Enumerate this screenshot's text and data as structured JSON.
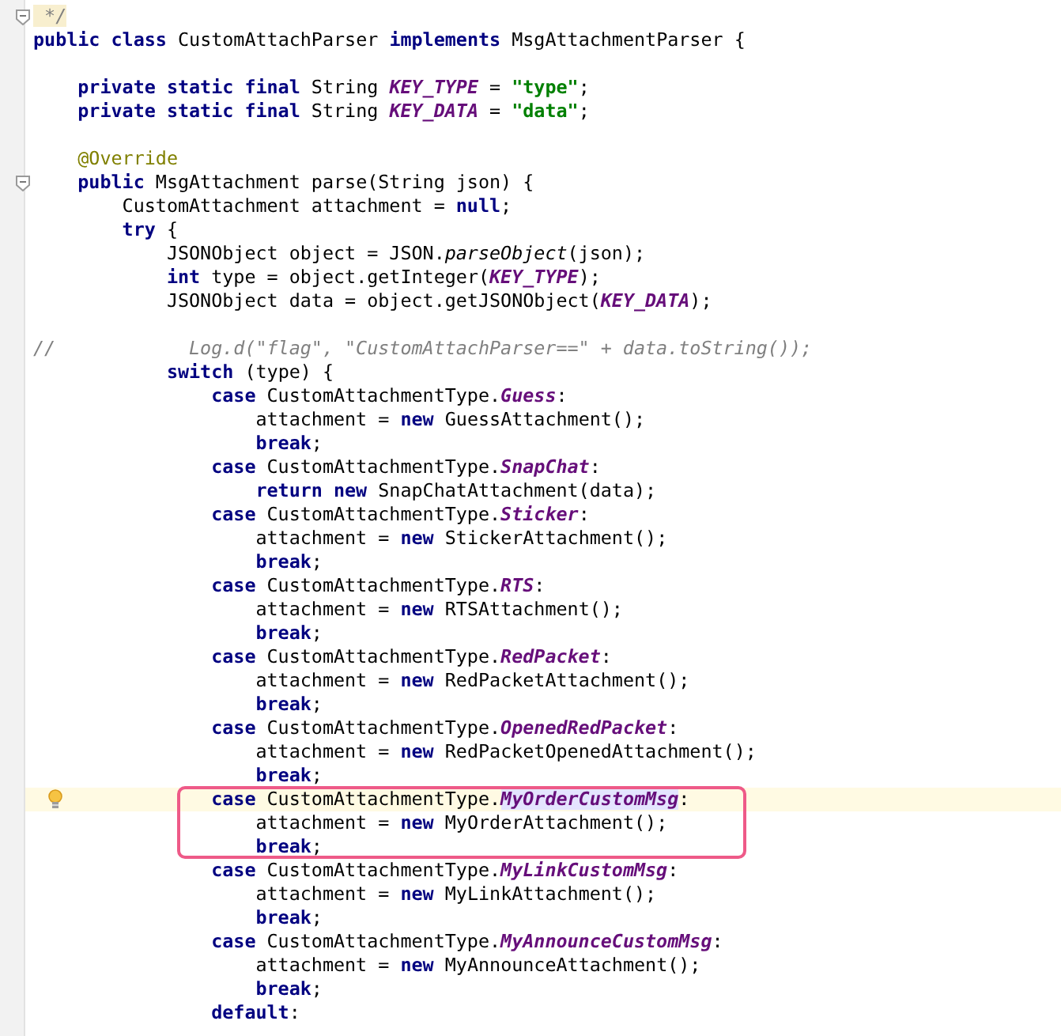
{
  "editor": {
    "lines": [
      {
        "kind": "code",
        "fold": true,
        "tokens": [
          {
            "kind": "doc",
            "text": " */"
          }
        ]
      },
      {
        "kind": "code",
        "tokens": [
          {
            "kind": "kw",
            "text": "public class"
          },
          {
            "kind": "plain",
            "text": " CustomAttachParser "
          },
          {
            "kind": "kw",
            "text": "implements"
          },
          {
            "kind": "plain",
            "text": " MsgAttachmentParser {"
          }
        ]
      },
      {
        "kind": "blank"
      },
      {
        "kind": "code",
        "tokens": [
          {
            "kind": "kw",
            "text": "    private static final"
          },
          {
            "kind": "plain",
            "text": " String "
          },
          {
            "kind": "field",
            "text": "KEY_TYPE"
          },
          {
            "kind": "plain",
            "text": " = "
          },
          {
            "kind": "str",
            "text": "\"type\""
          },
          {
            "kind": "plain",
            "text": ";"
          }
        ]
      },
      {
        "kind": "code",
        "tokens": [
          {
            "kind": "kw",
            "text": "    private static final"
          },
          {
            "kind": "plain",
            "text": " String "
          },
          {
            "kind": "field",
            "text": "KEY_DATA"
          },
          {
            "kind": "plain",
            "text": " = "
          },
          {
            "kind": "str",
            "text": "\"data\""
          },
          {
            "kind": "plain",
            "text": ";"
          }
        ]
      },
      {
        "kind": "blank"
      },
      {
        "kind": "code",
        "tokens": [
          {
            "kind": "ann",
            "text": "    @Override"
          }
        ]
      },
      {
        "kind": "code",
        "fold": true,
        "tokens": [
          {
            "kind": "kw",
            "text": "    public"
          },
          {
            "kind": "plain",
            "text": " MsgAttachment parse(String json) {"
          }
        ]
      },
      {
        "kind": "code",
        "tokens": [
          {
            "kind": "plain",
            "text": "        CustomAttachment attachment = "
          },
          {
            "kind": "kw",
            "text": "null"
          },
          {
            "kind": "plain",
            "text": ";"
          }
        ]
      },
      {
        "kind": "code",
        "tokens": [
          {
            "kind": "kw",
            "text": "        try"
          },
          {
            "kind": "plain",
            "text": " {"
          }
        ]
      },
      {
        "kind": "code",
        "tokens": [
          {
            "kind": "plain",
            "text": "            JSONObject object = JSON."
          },
          {
            "kind": "call",
            "text": "parseObject"
          },
          {
            "kind": "plain",
            "text": "(json);"
          }
        ]
      },
      {
        "kind": "code",
        "tokens": [
          {
            "kind": "kw",
            "text": "            int"
          },
          {
            "kind": "plain",
            "text": " type = object.getInteger("
          },
          {
            "kind": "field",
            "text": "KEY_TYPE"
          },
          {
            "kind": "plain",
            "text": ");"
          }
        ]
      },
      {
        "kind": "code",
        "tokens": [
          {
            "kind": "plain",
            "text": "            JSONObject data = object.getJSONObject("
          },
          {
            "kind": "field",
            "text": "KEY_DATA"
          },
          {
            "kind": "plain",
            "text": ");"
          }
        ]
      },
      {
        "kind": "blank"
      },
      {
        "kind": "code",
        "tokens": [
          {
            "kind": "comment",
            "text": "//            Log.d(\"flag\", \"CustomAttachParser==\" + data.toString());"
          }
        ]
      },
      {
        "kind": "code",
        "tokens": [
          {
            "kind": "kw",
            "text": "            switch"
          },
          {
            "kind": "plain",
            "text": " (type) {"
          }
        ]
      },
      {
        "kind": "code",
        "tokens": [
          {
            "kind": "kw",
            "text": "                case"
          },
          {
            "kind": "plain",
            "text": " CustomAttachmentType."
          },
          {
            "kind": "field",
            "text": "Guess"
          },
          {
            "kind": "plain",
            "text": ":"
          }
        ]
      },
      {
        "kind": "code",
        "tokens": [
          {
            "kind": "plain",
            "text": "                    attachment = "
          },
          {
            "kind": "kw",
            "text": "new"
          },
          {
            "kind": "plain",
            "text": " GuessAttachment();"
          }
        ]
      },
      {
        "kind": "code",
        "tokens": [
          {
            "kind": "kw",
            "text": "                    break"
          },
          {
            "kind": "plain",
            "text": ";"
          }
        ]
      },
      {
        "kind": "code",
        "tokens": [
          {
            "kind": "kw",
            "text": "                case"
          },
          {
            "kind": "plain",
            "text": " CustomAttachmentType."
          },
          {
            "kind": "field",
            "text": "SnapChat"
          },
          {
            "kind": "plain",
            "text": ":"
          }
        ]
      },
      {
        "kind": "code",
        "tokens": [
          {
            "kind": "kw",
            "text": "                    return new"
          },
          {
            "kind": "plain",
            "text": " SnapChatAttachment(data);"
          }
        ]
      },
      {
        "kind": "code",
        "tokens": [
          {
            "kind": "kw",
            "text": "                case"
          },
          {
            "kind": "plain",
            "text": " CustomAttachmentType."
          },
          {
            "kind": "field",
            "text": "Sticker"
          },
          {
            "kind": "plain",
            "text": ":"
          }
        ]
      },
      {
        "kind": "code",
        "tokens": [
          {
            "kind": "plain",
            "text": "                    attachment = "
          },
          {
            "kind": "kw",
            "text": "new"
          },
          {
            "kind": "plain",
            "text": " StickerAttachment();"
          }
        ]
      },
      {
        "kind": "code",
        "tokens": [
          {
            "kind": "kw",
            "text": "                    break"
          },
          {
            "kind": "plain",
            "text": ";"
          }
        ]
      },
      {
        "kind": "code",
        "tokens": [
          {
            "kind": "kw",
            "text": "                case"
          },
          {
            "kind": "plain",
            "text": " CustomAttachmentType."
          },
          {
            "kind": "field",
            "text": "RTS"
          },
          {
            "kind": "plain",
            "text": ":"
          }
        ]
      },
      {
        "kind": "code",
        "tokens": [
          {
            "kind": "plain",
            "text": "                    attachment = "
          },
          {
            "kind": "kw",
            "text": "new"
          },
          {
            "kind": "plain",
            "text": " RTSAttachment();"
          }
        ]
      },
      {
        "kind": "code",
        "tokens": [
          {
            "kind": "kw",
            "text": "                    break"
          },
          {
            "kind": "plain",
            "text": ";"
          }
        ]
      },
      {
        "kind": "code",
        "tokens": [
          {
            "kind": "kw",
            "text": "                case"
          },
          {
            "kind": "plain",
            "text": " CustomAttachmentType."
          },
          {
            "kind": "field",
            "text": "RedPacket"
          },
          {
            "kind": "plain",
            "text": ":"
          }
        ]
      },
      {
        "kind": "code",
        "tokens": [
          {
            "kind": "plain",
            "text": "                    attachment = "
          },
          {
            "kind": "kw",
            "text": "new"
          },
          {
            "kind": "plain",
            "text": " RedPacketAttachment();"
          }
        ]
      },
      {
        "kind": "code",
        "tokens": [
          {
            "kind": "kw",
            "text": "                    break"
          },
          {
            "kind": "plain",
            "text": ";"
          }
        ]
      },
      {
        "kind": "code",
        "tokens": [
          {
            "kind": "kw",
            "text": "                case"
          },
          {
            "kind": "plain",
            "text": " CustomAttachmentType."
          },
          {
            "kind": "field",
            "text": "OpenedRedPacket"
          },
          {
            "kind": "plain",
            "text": ":"
          }
        ]
      },
      {
        "kind": "code",
        "tokens": [
          {
            "kind": "plain",
            "text": "                    attachment = "
          },
          {
            "kind": "kw",
            "text": "new"
          },
          {
            "kind": "plain",
            "text": " RedPacketOpenedAttachment();"
          }
        ]
      },
      {
        "kind": "code",
        "tokens": [
          {
            "kind": "kw",
            "text": "                    break"
          },
          {
            "kind": "plain",
            "text": ";"
          }
        ]
      },
      {
        "kind": "frame",
        "lines": [
          {
            "kind": "code",
            "current": true,
            "bulb": true,
            "tokens": [
              {
                "kind": "kw",
                "text": "                case"
              },
              {
                "kind": "plain",
                "text": " CustomAttachmentType."
              },
              {
                "kind": "field-hl",
                "text": "MyOrderCustomMsg"
              },
              {
                "kind": "plain",
                "text": ":"
              }
            ]
          },
          {
            "kind": "code",
            "tokens": [
              {
                "kind": "plain",
                "text": "                    attachment = "
              },
              {
                "kind": "kw",
                "text": "new"
              },
              {
                "kind": "plain",
                "text": " MyOrderAttachment();"
              }
            ]
          },
          {
            "kind": "code",
            "tokens": [
              {
                "kind": "kw",
                "text": "                    break"
              },
              {
                "kind": "plain",
                "text": ";"
              }
            ]
          }
        ]
      },
      {
        "kind": "code",
        "tokens": [
          {
            "kind": "kw",
            "text": "                case"
          },
          {
            "kind": "plain",
            "text": " CustomAttachmentType."
          },
          {
            "kind": "field",
            "text": "MyLinkCustomMsg"
          },
          {
            "kind": "plain",
            "text": ":"
          }
        ]
      },
      {
        "kind": "code",
        "tokens": [
          {
            "kind": "plain",
            "text": "                    attachment = "
          },
          {
            "kind": "kw",
            "text": "new"
          },
          {
            "kind": "plain",
            "text": " MyLinkAttachment();"
          }
        ]
      },
      {
        "kind": "code",
        "tokens": [
          {
            "kind": "kw",
            "text": "                    break"
          },
          {
            "kind": "plain",
            "text": ";"
          }
        ]
      },
      {
        "kind": "code",
        "tokens": [
          {
            "kind": "kw",
            "text": "                case"
          },
          {
            "kind": "plain",
            "text": " CustomAttachmentType."
          },
          {
            "kind": "field",
            "text": "MyAnnounceCustomMsg"
          },
          {
            "kind": "plain",
            "text": ":"
          }
        ]
      },
      {
        "kind": "code",
        "tokens": [
          {
            "kind": "plain",
            "text": "                    attachment = "
          },
          {
            "kind": "kw",
            "text": "new"
          },
          {
            "kind": "plain",
            "text": " MyAnnounceAttachment();"
          }
        ]
      },
      {
        "kind": "code",
        "tokens": [
          {
            "kind": "kw",
            "text": "                    break"
          },
          {
            "kind": "plain",
            "text": ";"
          }
        ]
      },
      {
        "kind": "code",
        "tokens": [
          {
            "kind": "kw",
            "text": "                default"
          },
          {
            "kind": "plain",
            "text": ":"
          }
        ]
      }
    ]
  }
}
